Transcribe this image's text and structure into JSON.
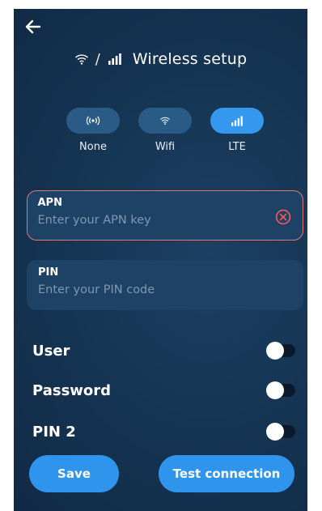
{
  "header": {
    "back_icon": "arrow-left-icon",
    "title": "Wireless setup",
    "separator": "/",
    "wifi_icon": "wifi-icon",
    "signal_icon": "cellular-signal-icon"
  },
  "modes": [
    {
      "label": "None",
      "icon": "antenna-broadcast-icon",
      "active": false
    },
    {
      "label": "Wifi",
      "icon": "wifi-icon",
      "active": false
    },
    {
      "label": "LTE",
      "icon": "cellular-signal-icon",
      "active": true
    }
  ],
  "apn": {
    "label": "APN",
    "placeholder": "Enter your APN key",
    "value": "",
    "error": true,
    "clear_icon": "clear-circle-icon"
  },
  "pin": {
    "label": "PIN",
    "placeholder": "Enter your PIN code",
    "value": ""
  },
  "toggles": [
    {
      "label": "User",
      "on": false
    },
    {
      "label": "Password",
      "on": false
    },
    {
      "label": "PIN 2",
      "on": false
    }
  ],
  "actions": {
    "save_label": "Save",
    "test_label": "Test connection"
  },
  "colors": {
    "background": "#153452",
    "pill": "#2a5a86",
    "accent": "#3498ef",
    "field": "#1e4266",
    "error": "#e57575"
  }
}
